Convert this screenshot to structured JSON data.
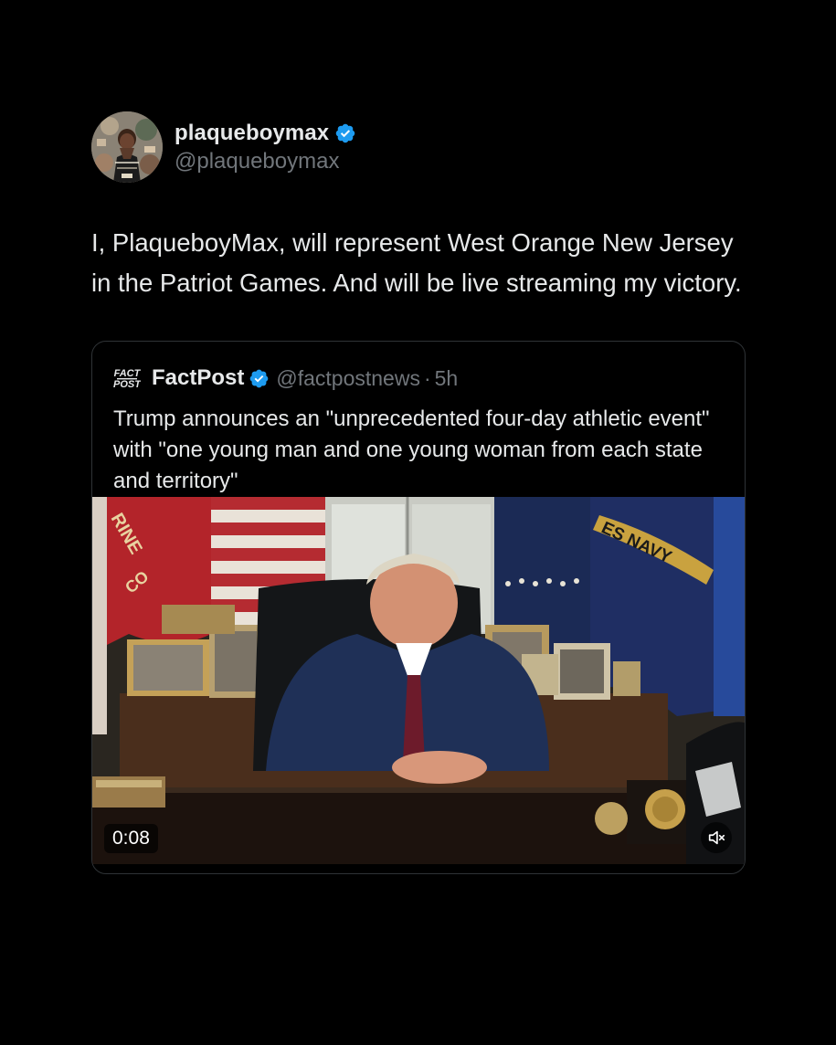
{
  "post": {
    "author": {
      "display_name": "plaqueboymax",
      "handle": "@plaqueboymax",
      "verified": true,
      "avatar_icon": "avatar-photo"
    },
    "text": "I, PlaqueboyMax, will represent West Orange New Jersey in the Patriot Games. And will be live streaming my victory."
  },
  "quoted_post": {
    "source_logo": "factpost-logo",
    "logo_text": [
      "FACT",
      "POST"
    ],
    "display_name": "FactPost",
    "handle": "@factpostnews",
    "separator": "·",
    "time": "5h",
    "verified": true,
    "text": "Trump announces an \"unprecedented four-day athletic event\" with \"one young man and one young woman from each state and territory\"",
    "media": {
      "type": "video",
      "timestamp": "0:08",
      "muted": true,
      "flag_text": [
        "RINE",
        "CO",
        "ES NAVY"
      ]
    }
  },
  "colors": {
    "background": "#000000",
    "text_primary": "#e7e9ea",
    "text_secondary": "#71767b",
    "verified_blue": "#1d9bf0",
    "card_border": "#2f3336"
  }
}
